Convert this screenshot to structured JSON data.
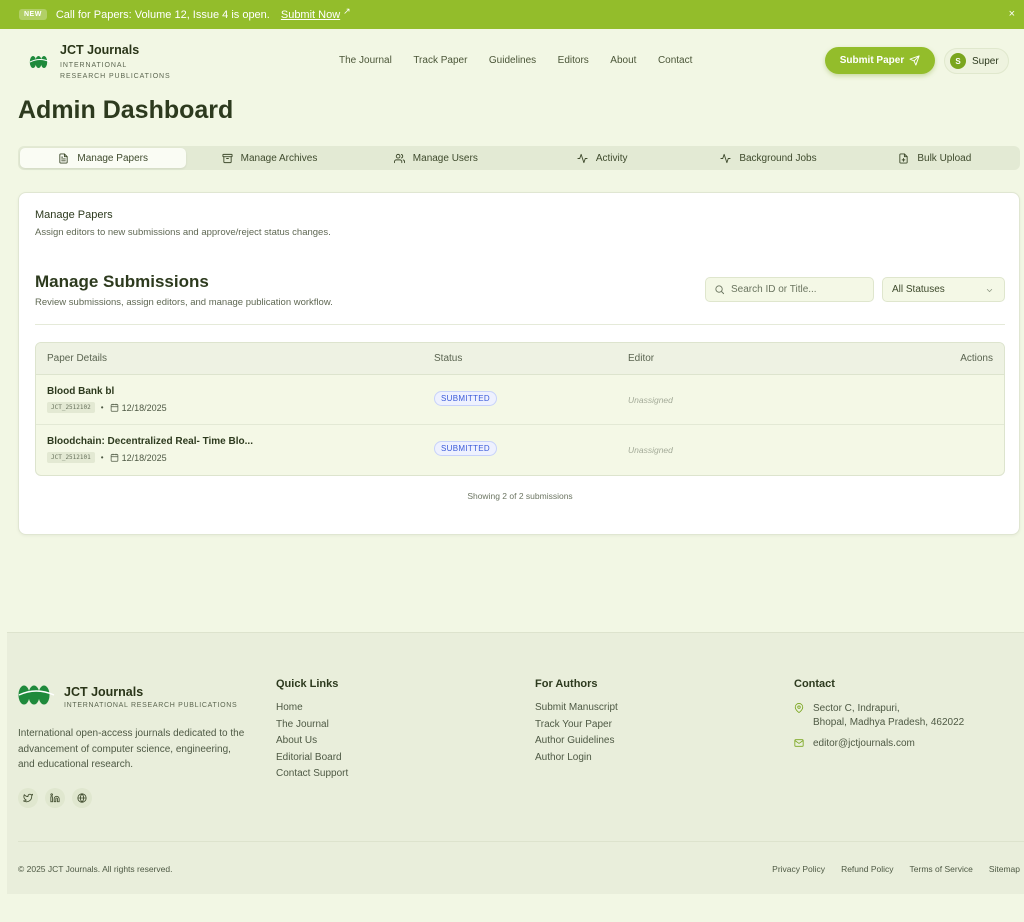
{
  "announcement": {
    "badge": "NEW",
    "text": "Call for Papers: Volume 12, Issue 4 is open.",
    "link": "Submit Now",
    "close": "×"
  },
  "brand": {
    "name": "JCT Journals",
    "tagline_line1": "INTERNATIONAL",
    "tagline_line2": "RESEARCH PUBLICATIONS",
    "color": "#93bd2b"
  },
  "nav": {
    "items": [
      "The Journal",
      "Track Paper",
      "Guidelines",
      "Editors",
      "About",
      "Contact"
    ]
  },
  "header": {
    "submit_label": "Submit Paper",
    "user_initial": "S",
    "user_name": "Super"
  },
  "page_title": "Admin Dashboard",
  "tabs": [
    {
      "label": "Manage Papers",
      "icon": "file-text-icon",
      "active": true
    },
    {
      "label": "Manage Archives",
      "icon": "archive-icon",
      "active": false
    },
    {
      "label": "Manage Users",
      "icon": "users-icon",
      "active": false
    },
    {
      "label": "Activity",
      "icon": "activity-icon",
      "active": false
    },
    {
      "label": "Background Jobs",
      "icon": "activity-icon",
      "active": false
    },
    {
      "label": "Bulk Upload",
      "icon": "file-plus-icon",
      "active": false
    }
  ],
  "card": {
    "title": "Manage Papers",
    "description": "Assign editors to new submissions and approve/reject status changes.",
    "section_title": "Manage Submissions",
    "section_description": "Review submissions, assign editors, and manage publication workflow.",
    "search_placeholder": "Search ID or Title...",
    "status_filter": "All Statuses",
    "columns": [
      "Paper Details",
      "Status",
      "Editor",
      "Actions"
    ],
    "rows": [
      {
        "title": "Blood Bank bl",
        "id": "JCT_2512102",
        "date": "12/18/2025",
        "status": "SUBMITTED",
        "editor": "Unassigned"
      },
      {
        "title": "Bloodchain: Decentralized Real- Time Blo...",
        "id": "JCT_2512101",
        "date": "12/18/2025",
        "status": "SUBMITTED",
        "editor": "Unassigned"
      }
    ],
    "showing": "Showing 2 of 2 submissions"
  },
  "footer": {
    "brand_name": "JCT Journals",
    "brand_tagline": "INTERNATIONAL RESEARCH PUBLICATIONS",
    "about": "International open-access journals dedicated to the advancement of computer science, engineering, and educational research.",
    "quick_links_title": "Quick Links",
    "quick_links": [
      "Home",
      "The Journal",
      "About Us",
      "Editorial Board",
      "Contact Support"
    ],
    "authors_title": "For Authors",
    "authors_links": [
      "Submit Manuscript",
      "Track Your Paper",
      "Author Guidelines",
      "Author Login"
    ],
    "contact_title": "Contact",
    "address_line1": "Sector C, Indrapuri,",
    "address_line2": "Bhopal, Madhya Pradesh, 462022",
    "email": "editor@jctjournals.com",
    "copyright": "© 2025 JCT Journals. All rights reserved.",
    "legal": [
      "Privacy Policy",
      "Refund Policy",
      "Terms of Service",
      "Sitemap"
    ]
  }
}
